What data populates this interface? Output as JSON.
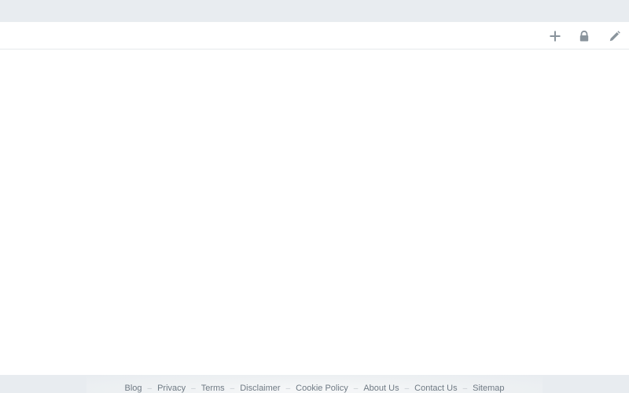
{
  "toolbar": {
    "buttons": [
      {
        "icon": "plus-icon"
      },
      {
        "icon": "lock-icon"
      },
      {
        "icon": "pencil-icon"
      }
    ],
    "icon_color": "#8a949c"
  },
  "footer": {
    "separator": "–",
    "links": [
      {
        "label": "Blog"
      },
      {
        "label": "Privacy"
      },
      {
        "label": "Terms"
      },
      {
        "label": "Disclaimer"
      },
      {
        "label": "Cookie Policy"
      },
      {
        "label": "About Us"
      },
      {
        "label": "Contact Us"
      },
      {
        "label": "Sitemap"
      }
    ]
  }
}
